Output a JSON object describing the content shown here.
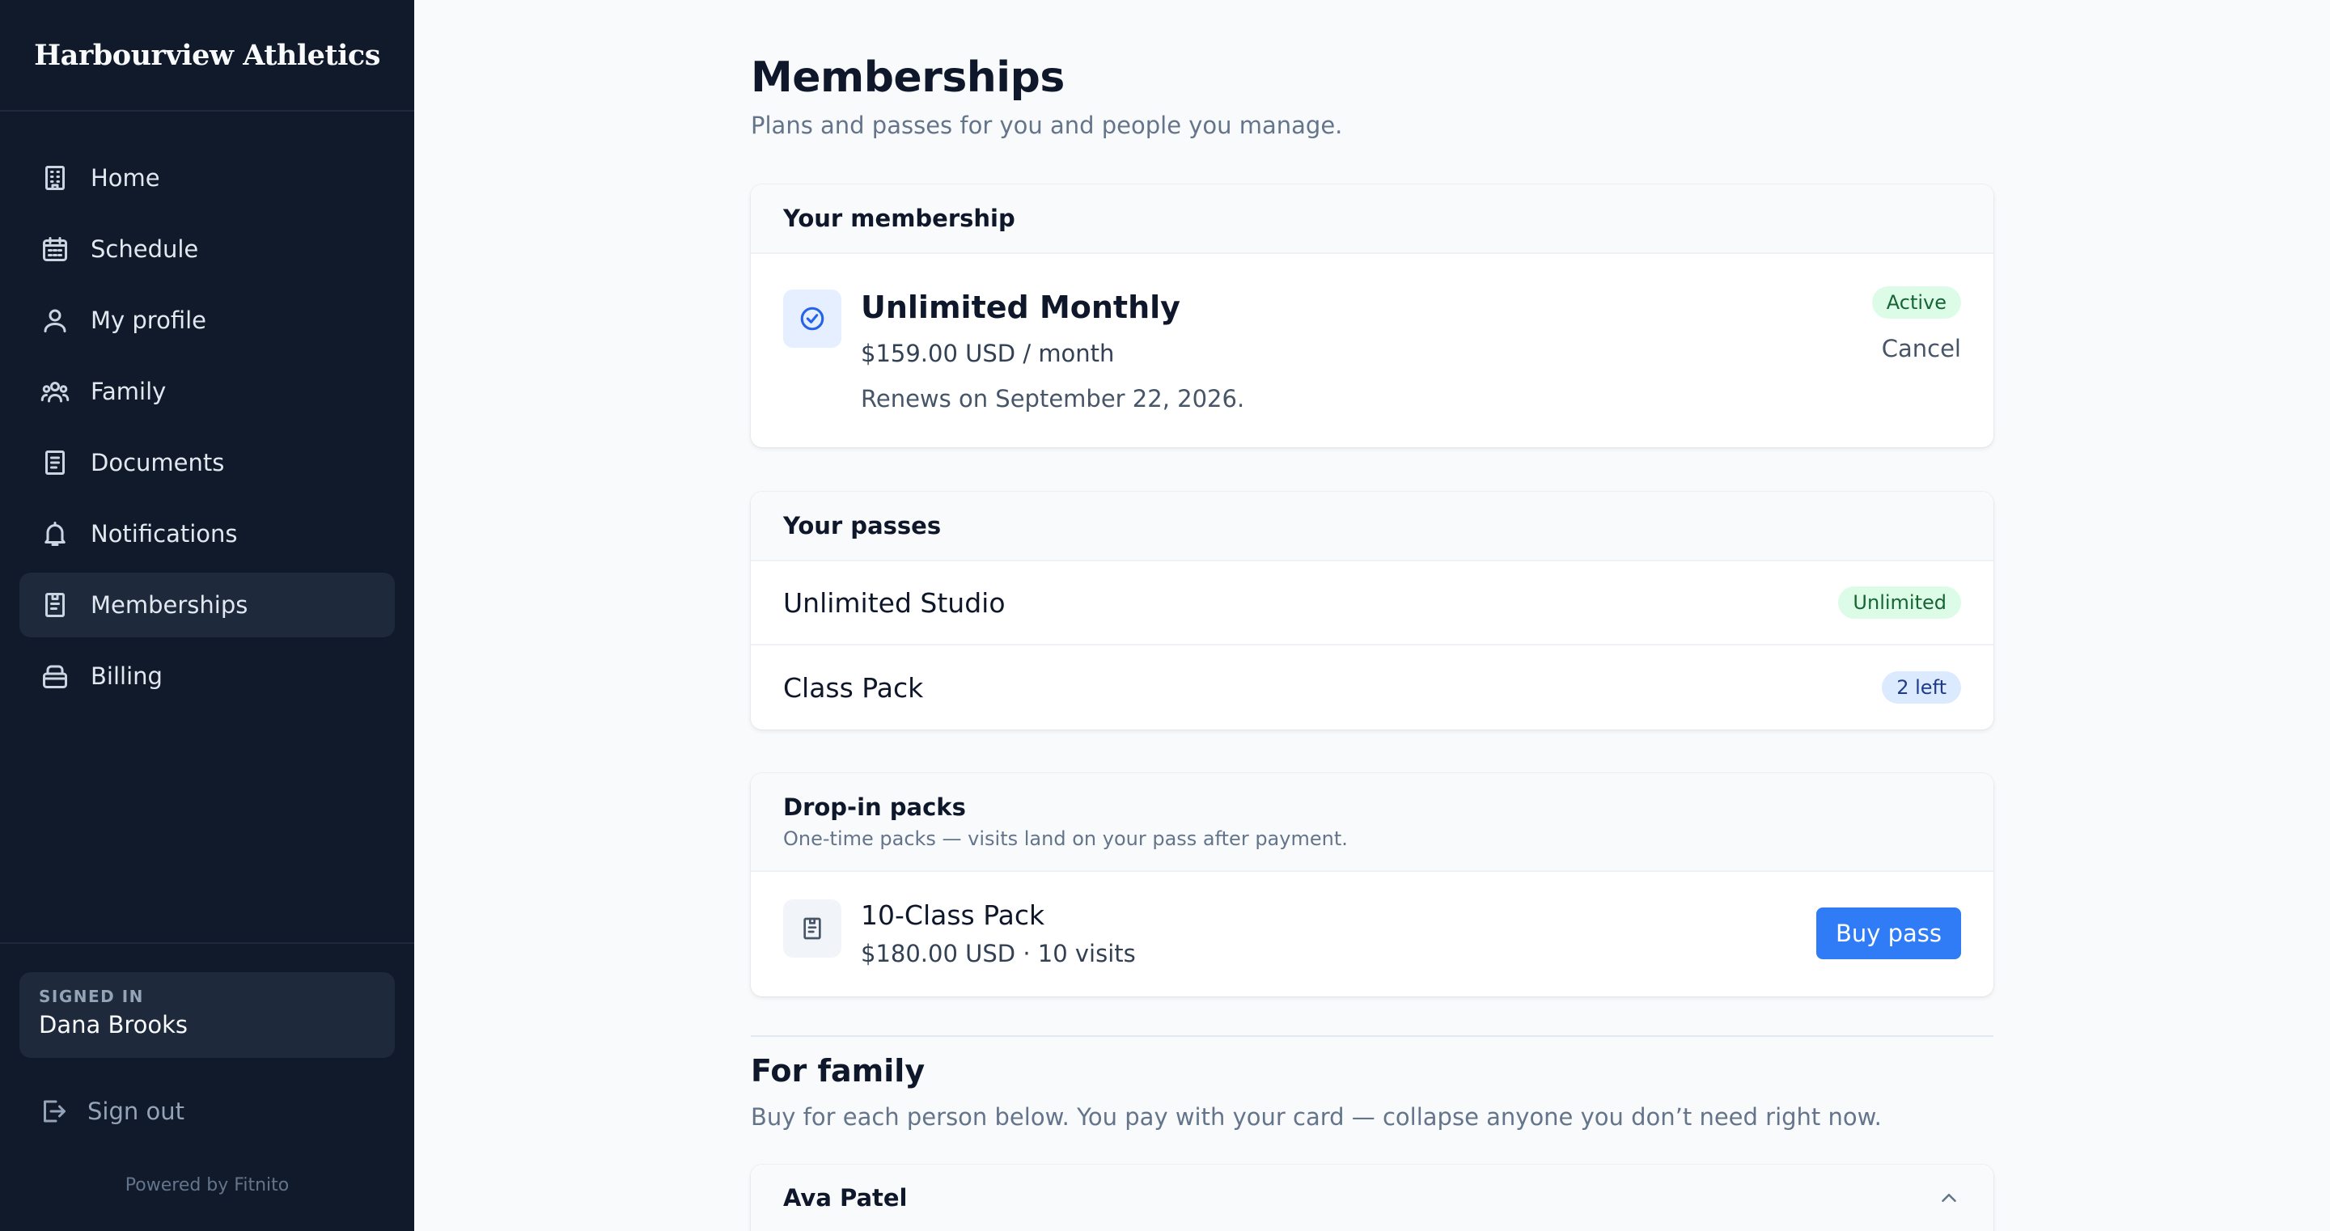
{
  "brand": "Harbourview Athletics",
  "sidebar": {
    "items": [
      {
        "label": "Home",
        "icon": "building-icon"
      },
      {
        "label": "Schedule",
        "icon": "calendar-icon"
      },
      {
        "label": "My profile",
        "icon": "user-icon"
      },
      {
        "label": "Family",
        "icon": "users-icon"
      },
      {
        "label": "Documents",
        "icon": "document-icon"
      },
      {
        "label": "Notifications",
        "icon": "bell-icon"
      },
      {
        "label": "Memberships",
        "icon": "clipboard-icon",
        "active": true
      },
      {
        "label": "Billing",
        "icon": "wallet-icon"
      }
    ],
    "signed_in_label": "SIGNED IN",
    "signed_in_name": "Dana Brooks",
    "sign_out": "Sign out",
    "powered_by": "Powered by Fitnito"
  },
  "page": {
    "title": "Memberships",
    "subtitle": "Plans and passes for you and people you manage."
  },
  "membership": {
    "heading": "Your membership",
    "plan_name": "Unlimited Monthly",
    "price": "$159.00 USD / month",
    "renewal": "Renews on September 22, 2026.",
    "status": "Active",
    "cancel_label": "Cancel"
  },
  "passes": {
    "heading": "Your passes",
    "items": [
      {
        "name": "Unlimited Studio",
        "badge": "Unlimited",
        "badge_color": "#dcfce7"
      },
      {
        "name": "Class Pack",
        "badge": "2 left",
        "badge_color": "#dbeafe"
      }
    ]
  },
  "drop_in": {
    "heading": "Drop-in packs",
    "description": "One-time packs — visits land on your pass after payment.",
    "pack": {
      "name": "10-Class Pack",
      "meta": "$180.00 USD · 10 visits",
      "button": "Buy pass"
    }
  },
  "family": {
    "title": "For family",
    "subtitle": "Buy for each person below. You pay with your card — collapse anyone you don’t need right now.",
    "people": [
      {
        "name": "Ava Patel",
        "expanded": true
      }
    ]
  },
  "colors": {
    "sidebar_bg": "#111a2b",
    "accent": "#2f7cf6"
  }
}
